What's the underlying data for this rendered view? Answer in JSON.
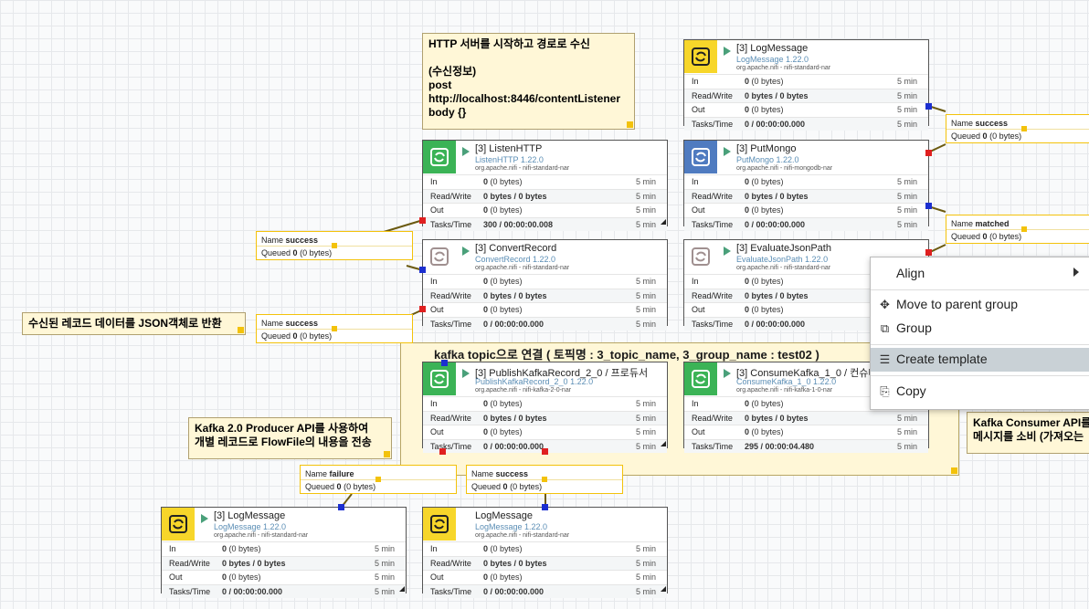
{
  "labels": {
    "http_label": {
      "line1": "HTTP 서버를 시작하고 경로로 수신",
      "line2": "(수신정보)",
      "line3": "post",
      "line4": "http://localhost:8446/contentListener",
      "line5": "body {}"
    },
    "json_label": "수신된 레코드 데이터를 JSON객체로 반환",
    "producer_label": {
      "line1": "Kafka 2.0 Producer API를 사용하여",
      "line2": "개별 레코드로 FlowFile의 내용을 전송"
    },
    "consumer_label": {
      "line1": "Kafka Consumer API를",
      "line2": "메시지를 소비 (가져오는"
    }
  },
  "group": {
    "title": "kafka topic으로 연결 ( 토픽명 : 3_topic_name, 3_group_name : test02 )"
  },
  "stat_keys": {
    "in": "In",
    "rw": "Read/Write",
    "out": "Out",
    "tasks": "Tasks/Time",
    "window": "5 min"
  },
  "processors": {
    "log_top": {
      "name": "[3] LogMessage",
      "type": "LogMessage 1.22.0",
      "bundle": "org.apache.nifi - nifi-standard-nar",
      "in_count": "0",
      "in_bytes": "(0 bytes)",
      "rw": "0 bytes / 0 bytes",
      "out_count": "0",
      "out_bytes": "(0 bytes)",
      "tasks": "0 / 00:00:00.000"
    },
    "listen_http": {
      "name": "[3] ListenHTTP",
      "type": "ListenHTTP 1.22.0",
      "bundle": "org.apache.nifi - nifi-standard-nar",
      "in_count": "0",
      "in_bytes": "(0 bytes)",
      "rw": "0 bytes / 0 bytes",
      "out_count": "0",
      "out_bytes": "(0 bytes)",
      "tasks": "300 / 00:00:00.008"
    },
    "put_mongo": {
      "name": "[3] PutMongo",
      "type": "PutMongo 1.22.0",
      "bundle": "org.apache.nifi - nifi-mongodb-nar",
      "in_count": "0",
      "in_bytes": "(0 bytes)",
      "rw": "0 bytes / 0 bytes",
      "out_count": "0",
      "out_bytes": "(0 bytes)",
      "tasks": "0 / 00:00:00.000"
    },
    "convert_record": {
      "name": "[3] ConvertRecord",
      "type": "ConvertRecord 1.22.0",
      "bundle": "org.apache.nifi - nifi-standard-nar",
      "in_count": "0",
      "in_bytes": "(0 bytes)",
      "rw": "0 bytes / 0 bytes",
      "out_count": "0",
      "out_bytes": "(0 bytes)",
      "tasks": "0 / 00:00:00.000"
    },
    "evaluate_json": {
      "name": "[3] EvaluateJsonPath",
      "type": "EvaluateJsonPath 1.22.0",
      "bundle": "org.apache.nifi - nifi-standard-nar",
      "in_count": "0",
      "in_bytes": "(0 bytes)",
      "rw": "0 bytes / 0 bytes",
      "out_count": "0",
      "out_bytes": "(0 bytes)",
      "tasks": "0 / 00:00:00.000"
    },
    "publish_kafka": {
      "name": "[3] PublishKafkaRecord_2_0 / 프로듀서",
      "type": "PublishKafkaRecord_2_0 1.22.0",
      "bundle": "org.apache.nifi - nifi-kafka-2-0-nar",
      "in_count": "0",
      "in_bytes": "(0 bytes)",
      "rw": "0 bytes / 0 bytes",
      "out_count": "0",
      "out_bytes": "(0 bytes)",
      "tasks": "0 / 00:00:00.000"
    },
    "consume_kafka": {
      "name": "[3] ConsumeKafka_1_0 / 컨슈머",
      "type": "ConsumeKafka_1_0 1.22.0",
      "bundle": "org.apache.nifi - nifi-kafka-1-0-nar",
      "in_count": "0",
      "in_bytes": "(0 bytes)",
      "rw": "0 bytes / 0 bytes",
      "out_count": "0",
      "out_bytes": "(0 bytes)",
      "tasks": "295 / 00:00:04.480"
    },
    "log_bottom_left": {
      "name": "[3] LogMessage",
      "type": "LogMessage 1.22.0",
      "bundle": "org.apache.nifi - nifi-standard-nar",
      "in_count": "0",
      "in_bytes": "(0 bytes)",
      "rw": "0 bytes / 0 bytes",
      "out_count": "0",
      "out_bytes": "(0 bytes)",
      "tasks": "0 / 00:00:00.000"
    },
    "log_bottom": {
      "name": "LogMessage",
      "type": "LogMessage 1.22.0",
      "bundle": "org.apache.nifi - nifi-standard-nar",
      "in_count": "0",
      "in_bytes": "(0 bytes)",
      "rw": "0 bytes / 0 bytes",
      "out_count": "0",
      "out_bytes": "(0 bytes)",
      "tasks": "0 / 00:00:00.000"
    }
  },
  "connections": {
    "name_key": "Name",
    "queued_key": "Queued",
    "c_success_left": {
      "name": "success",
      "count": "0",
      "bytes": "(0 bytes)"
    },
    "c_success_left2": {
      "name": "success",
      "count": "0",
      "bytes": "(0 bytes)"
    },
    "c_success_right": {
      "name": "success",
      "count": "0",
      "bytes": "(0 bytes)"
    },
    "c_matched_right": {
      "name": "matched",
      "count": "0",
      "bytes": "(0 bytes)"
    },
    "c_failure": {
      "name": "failure",
      "count": "0",
      "bytes": "(0 bytes)"
    },
    "c_success_bottom": {
      "name": "success",
      "count": "0",
      "bytes": "(0 bytes)"
    }
  },
  "context_menu": {
    "align": "Align",
    "move_parent": "Move to parent group",
    "group": "Group",
    "create_template": "Create template",
    "copy": "Copy"
  },
  "colors": {
    "processor_green": "#3bb356",
    "processor_yellow": "#f7d62a",
    "processor_blue": "#4f7bc0",
    "label_bg": "#fff7d7",
    "highlight": "#c9d1d6"
  }
}
